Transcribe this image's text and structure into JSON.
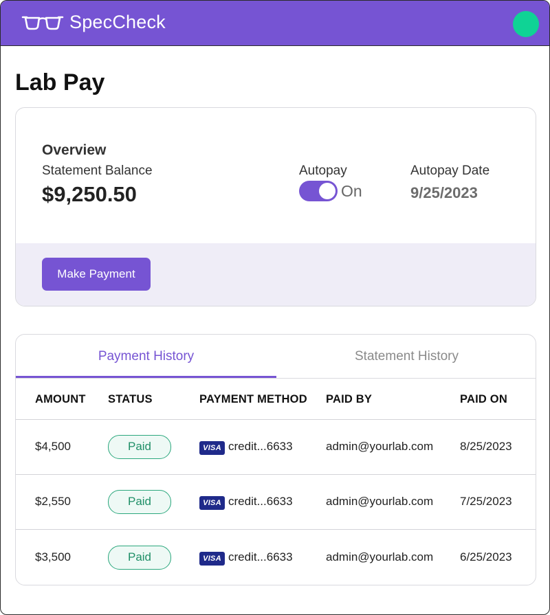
{
  "app": {
    "name": "SpecCheck",
    "logo_icon": "glasses-icon",
    "accent_color": "#7654d3",
    "avatar_color": "#0fd395"
  },
  "page": {
    "title": "Lab Pay"
  },
  "overview": {
    "title": "Overview",
    "balance_label": "Statement Balance",
    "balance_value": "$9,250.50",
    "autopay_label": "Autopay",
    "autopay_state": "On",
    "autopay_enabled": true,
    "autopay_date_label": "Autopay Date",
    "autopay_date_value": "9/25/2023",
    "make_payment_label": "Make Payment"
  },
  "history": {
    "tabs": [
      {
        "label": "Payment History",
        "active": true
      },
      {
        "label": "Statement History",
        "active": false
      }
    ],
    "columns": [
      "AMOUNT",
      "STATUS",
      "PAYMENT METHOD",
      "PAID BY",
      "PAID ON"
    ],
    "rows": [
      {
        "amount": "$4,500",
        "status": "Paid",
        "card_brand": "VISA",
        "method": "credit...6633",
        "paid_by": "admin@yourlab.com",
        "paid_on": "8/25/2023"
      },
      {
        "amount": "$2,550",
        "status": "Paid",
        "card_brand": "VISA",
        "method": "credit...6633",
        "paid_by": "admin@yourlab.com",
        "paid_on": "7/25/2023"
      },
      {
        "amount": "$3,500",
        "status": "Paid",
        "card_brand": "VISA",
        "method": "credit...6633",
        "paid_by": "admin@yourlab.com",
        "paid_on": "6/25/2023"
      }
    ],
    "status_color": "#2aa77c"
  }
}
